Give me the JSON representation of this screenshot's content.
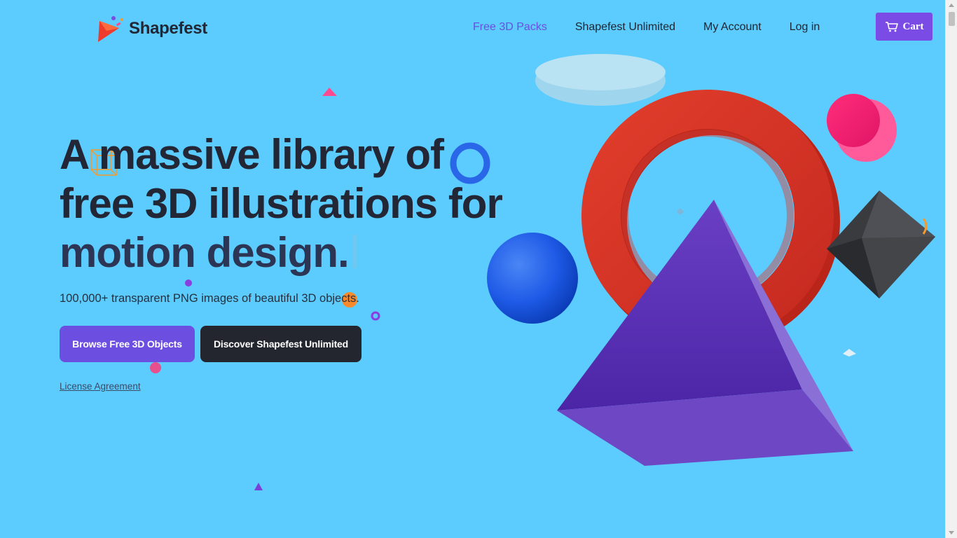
{
  "brand": {
    "name": "Shapefest"
  },
  "nav": {
    "items": [
      {
        "label": "Free 3D Packs",
        "active": true
      },
      {
        "label": "Shapefest Unlimited",
        "active": false
      },
      {
        "label": "My Account",
        "active": false
      },
      {
        "label": "Log in",
        "active": false
      }
    ],
    "cart_label": "Cart"
  },
  "hero": {
    "headline_line1": "A massive library of",
    "headline_line2": "free 3D illustrations for",
    "headline_line3": "motion design.",
    "subtitle": "100,000+ transparent PNG images of beautiful 3D objects.",
    "primary_button": "Browse Free 3D Objects",
    "secondary_button": "Discover Shapefest Unlimited",
    "license_link": "License Agreement"
  },
  "colors": {
    "background": "#5ccbfd",
    "accent": "#6c4fe0",
    "cart": "#7b4ce5",
    "dark": "#23252f"
  },
  "icons": [
    "shapefest-logo-icon",
    "cart-icon"
  ]
}
